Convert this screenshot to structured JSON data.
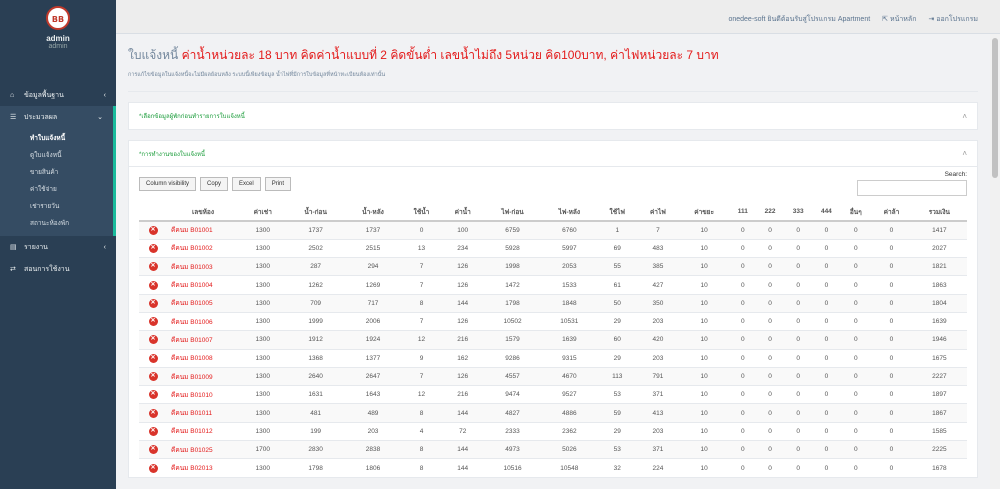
{
  "user": {
    "name": "admin",
    "role": "admin",
    "logo_text": "BB"
  },
  "sidebar": {
    "items": [
      {
        "label": "ข้อมูลพื้นฐาน",
        "icon": "home-icon"
      },
      {
        "label": "ประมวลผล",
        "icon": "list-icon"
      },
      {
        "label": "รายงาน",
        "icon": "file-icon"
      },
      {
        "label": "สอนการใช้งาน",
        "icon": "signout-icon"
      }
    ],
    "sub_items": [
      "ทำใบแจ้งหนี้",
      "ดูใบแจ้งหนี้",
      "ขายสินค้า",
      "ค่าใช้จ่าย",
      "เช่ารายวัน",
      "สถานะห้องพัก"
    ]
  },
  "topbar": {
    "company": "onedee-soft ยินดีต้อนรับสู่โปรแกรม Apartment",
    "home": "หน้าหลัก",
    "logout": "ออกโปรแกรม"
  },
  "page": {
    "title_prefix": "ใบแจ้งหนี้",
    "title_detail": "ค่าน้ำหน่วยละ 18 บาท คิดค่าน้ำแบบที่ 2 คิดขั้นต่ำ เลขน้ำไม่ถึง 5หน่วย คิด100บาท, ค่าไฟหน่วยละ 7 บาท",
    "subtitle": "การแก้ไขข้อมูลในแจ้งหนี้จะไม่มีผลย้อนหลัง ระบบนี้เพียงข้อมูล น้ำไฟที่มีการใบข้อมูลที่หน้าทะเบียนห้องเท่านั้น"
  },
  "panel1": {
    "title": "*เลือกข้อมูลผู้พักก่อนทำรายการใบแจ้งหนี้"
  },
  "panel2": {
    "title": "*การทำงานของใบแจ้งหนี้"
  },
  "buttons": {
    "colvis": "Column visibility",
    "copy": "Copy",
    "excel": "Excel",
    "print": "Print"
  },
  "search": {
    "label": "Search:"
  },
  "table": {
    "headers": [
      "",
      "เลขห้อง",
      "ค่าเช่า",
      "น้ำ-ก่อน",
      "น้ำ-หลัง",
      "ใช้น้ำ",
      "ค่าน้ำ",
      "ไฟ-ก่อน",
      "ไฟ-หลัง",
      "ใช้ไฟ",
      "ค่าไฟ",
      "ค่าขยะ",
      "111",
      "222",
      "333",
      "444",
      "อื่นๆ",
      "ค่าล้า",
      "รวมเงิน"
    ],
    "rows": [
      [
        "คีคนม B01001",
        "1300",
        "1737",
        "1737",
        "0",
        "100",
        "6759",
        "6760",
        "1",
        "7",
        "10",
        "0",
        "0",
        "0",
        "0",
        "0",
        "0",
        "1417"
      ],
      [
        "คีคนม B01002",
        "1300",
        "2502",
        "2515",
        "13",
        "234",
        "5928",
        "5997",
        "69",
        "483",
        "10",
        "0",
        "0",
        "0",
        "0",
        "0",
        "0",
        "2027"
      ],
      [
        "คีคนม B01003",
        "1300",
        "287",
        "294",
        "7",
        "126",
        "1998",
        "2053",
        "55",
        "385",
        "10",
        "0",
        "0",
        "0",
        "0",
        "0",
        "0",
        "1821"
      ],
      [
        "คีคนม B01004",
        "1300",
        "1262",
        "1269",
        "7",
        "126",
        "1472",
        "1533",
        "61",
        "427",
        "10",
        "0",
        "0",
        "0",
        "0",
        "0",
        "0",
        "1863"
      ],
      [
        "คีคนม B01005",
        "1300",
        "709",
        "717",
        "8",
        "144",
        "1798",
        "1848",
        "50",
        "350",
        "10",
        "0",
        "0",
        "0",
        "0",
        "0",
        "0",
        "1804"
      ],
      [
        "คีคนม B01006",
        "1300",
        "1999",
        "2006",
        "7",
        "126",
        "10502",
        "10531",
        "29",
        "203",
        "10",
        "0",
        "0",
        "0",
        "0",
        "0",
        "0",
        "1639"
      ],
      [
        "คีคนม B01007",
        "1300",
        "1912",
        "1924",
        "12",
        "216",
        "1579",
        "1639",
        "60",
        "420",
        "10",
        "0",
        "0",
        "0",
        "0",
        "0",
        "0",
        "1946"
      ],
      [
        "คีคนม B01008",
        "1300",
        "1368",
        "1377",
        "9",
        "162",
        "9286",
        "9315",
        "29",
        "203",
        "10",
        "0",
        "0",
        "0",
        "0",
        "0",
        "0",
        "1675"
      ],
      [
        "คีคนม B01009",
        "1300",
        "2640",
        "2647",
        "7",
        "126",
        "4557",
        "4670",
        "113",
        "791",
        "10",
        "0",
        "0",
        "0",
        "0",
        "0",
        "0",
        "2227"
      ],
      [
        "คีคนม B01010",
        "1300",
        "1631",
        "1643",
        "12",
        "216",
        "9474",
        "9527",
        "53",
        "371",
        "10",
        "0",
        "0",
        "0",
        "0",
        "0",
        "0",
        "1897"
      ],
      [
        "คีคนม B01011",
        "1300",
        "481",
        "489",
        "8",
        "144",
        "4827",
        "4886",
        "59",
        "413",
        "10",
        "0",
        "0",
        "0",
        "0",
        "0",
        "0",
        "1867"
      ],
      [
        "คีคนม B01012",
        "1300",
        "199",
        "203",
        "4",
        "72",
        "2333",
        "2362",
        "29",
        "203",
        "10",
        "0",
        "0",
        "0",
        "0",
        "0",
        "0",
        "1585"
      ],
      [
        "คีคนม B01025",
        "1700",
        "2830",
        "2838",
        "8",
        "144",
        "4973",
        "5026",
        "53",
        "371",
        "10",
        "0",
        "0",
        "0",
        "0",
        "0",
        "0",
        "2225"
      ],
      [
        "คีคนม B02013",
        "1300",
        "1798",
        "1806",
        "8",
        "144",
        "10516",
        "10548",
        "32",
        "224",
        "10",
        "0",
        "0",
        "0",
        "0",
        "0",
        "0",
        "1678"
      ]
    ]
  }
}
